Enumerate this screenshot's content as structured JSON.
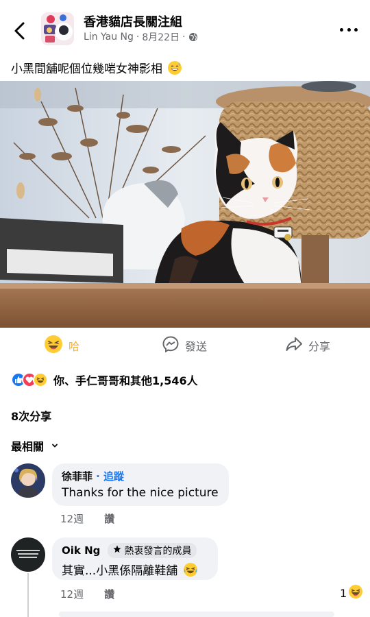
{
  "header": {
    "group_name": "香港貓店長關注組",
    "author": "Lin Yau Ng",
    "date": "8月22日",
    "separator": "·",
    "icons": [
      "back-arrow-icon",
      "globe-icon",
      "more-icon"
    ]
  },
  "post": {
    "caption": "小黑間舖呢個位幾啱女神影相",
    "caption_emoji": "grinning-sweat-emoji"
  },
  "actions": {
    "haha_label": "哈",
    "send_label": "發送",
    "share_label": "分享"
  },
  "reactions": {
    "types": [
      "like",
      "love",
      "haha"
    ],
    "summary": "你、手仁哥哥和其他1,546人"
  },
  "shares": "8次分享",
  "sort_label": "最相關",
  "comments": [
    {
      "name": "徐菲菲",
      "follow": "追蹤",
      "text": "Thanks for the nice picture",
      "time": "12週",
      "like_label": "讚"
    },
    {
      "name": "Oik Ng",
      "badge": "熱衷發言的成員",
      "text": "其實...小黑係隔離鞋舖",
      "time": "12週",
      "like_label": "讚",
      "reaction_count": "1"
    }
  ],
  "colors": {
    "accent": "#1877f2",
    "haha": "#f7b125",
    "secondary_text": "#65676b",
    "bubble": "#f0f2f5"
  }
}
